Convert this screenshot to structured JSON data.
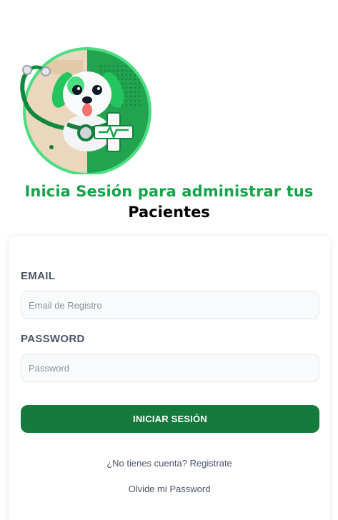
{
  "header": {
    "title_line1": "Inicia Sesión para administrar tus",
    "title_line2": "Pacientes"
  },
  "logo": {
    "icon": "dog-vet-logo-icon"
  },
  "form": {
    "email_label": "EMAIL",
    "email_placeholder": "Email de Registro",
    "email_value": "",
    "password_label": "PASSWORD",
    "password_placeholder": "Password",
    "password_value": "",
    "submit_label": "Iniciar Sesión"
  },
  "links": {
    "register": "¿No tienes cuenta? Registrate",
    "forgot": "Olvide mi Password"
  },
  "colors": {
    "accent": "#16a34a",
    "button": "#157a3c",
    "label": "#4b5563"
  }
}
